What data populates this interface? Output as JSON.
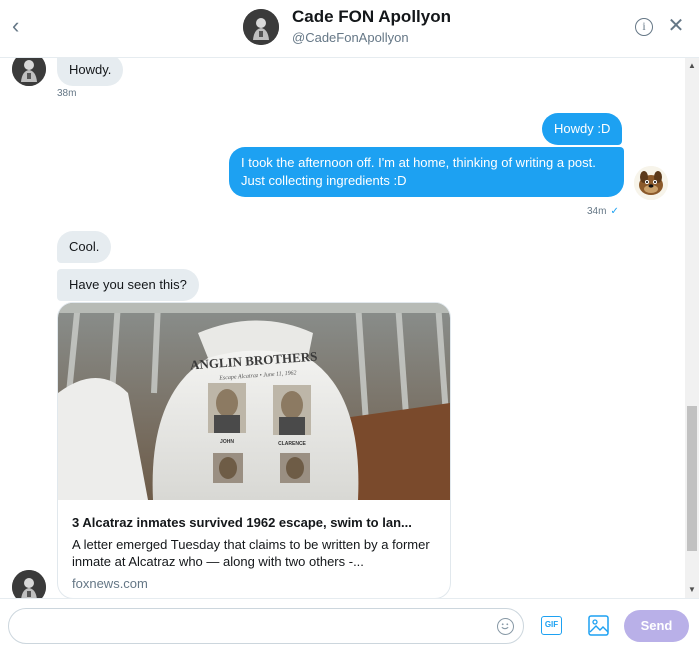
{
  "header": {
    "name": "Cade FON Apollyon",
    "handle": "@CadeFonApollyon",
    "back_icon": "‹",
    "info_icon": "i",
    "close_icon": "✕"
  },
  "messages": {
    "m1": {
      "text": "Howdy.",
      "time": "38m"
    },
    "m2": {
      "text": "Howdy :D"
    },
    "m3": {
      "text": "I took the afternoon off. I'm at home, thinking of writing a post. Just collecting ingredients :D",
      "time": "34m",
      "check": "✓"
    },
    "m4": {
      "text": "Cool."
    },
    "m5": {
      "text": "Have you seen this?"
    }
  },
  "card": {
    "title": "3 Alcatraz inmates survived 1962 escape, swim to lan...",
    "description": "A letter emerged Tuesday that claims to be written by a former inmate at Alcatraz who — along with two others -...",
    "domain": "foxnews.com",
    "image_text": {
      "banner": "ANGLIN BROTHERS",
      "sub": "Escape Alcatraz • June 11, 1962",
      "name_left": "JOHN",
      "name_right": "CLARENCE"
    }
  },
  "composer": {
    "placeholder": "",
    "gif_label": "GIF",
    "send_label": "Send"
  },
  "colors": {
    "accent": "#1da1f2",
    "send_disabled": "#b9b0e8",
    "bubble_in": "#e6ecf0"
  },
  "icons": [
    "back-icon",
    "info-icon",
    "close-icon",
    "emoji-icon",
    "gif-icon",
    "media-icon"
  ]
}
